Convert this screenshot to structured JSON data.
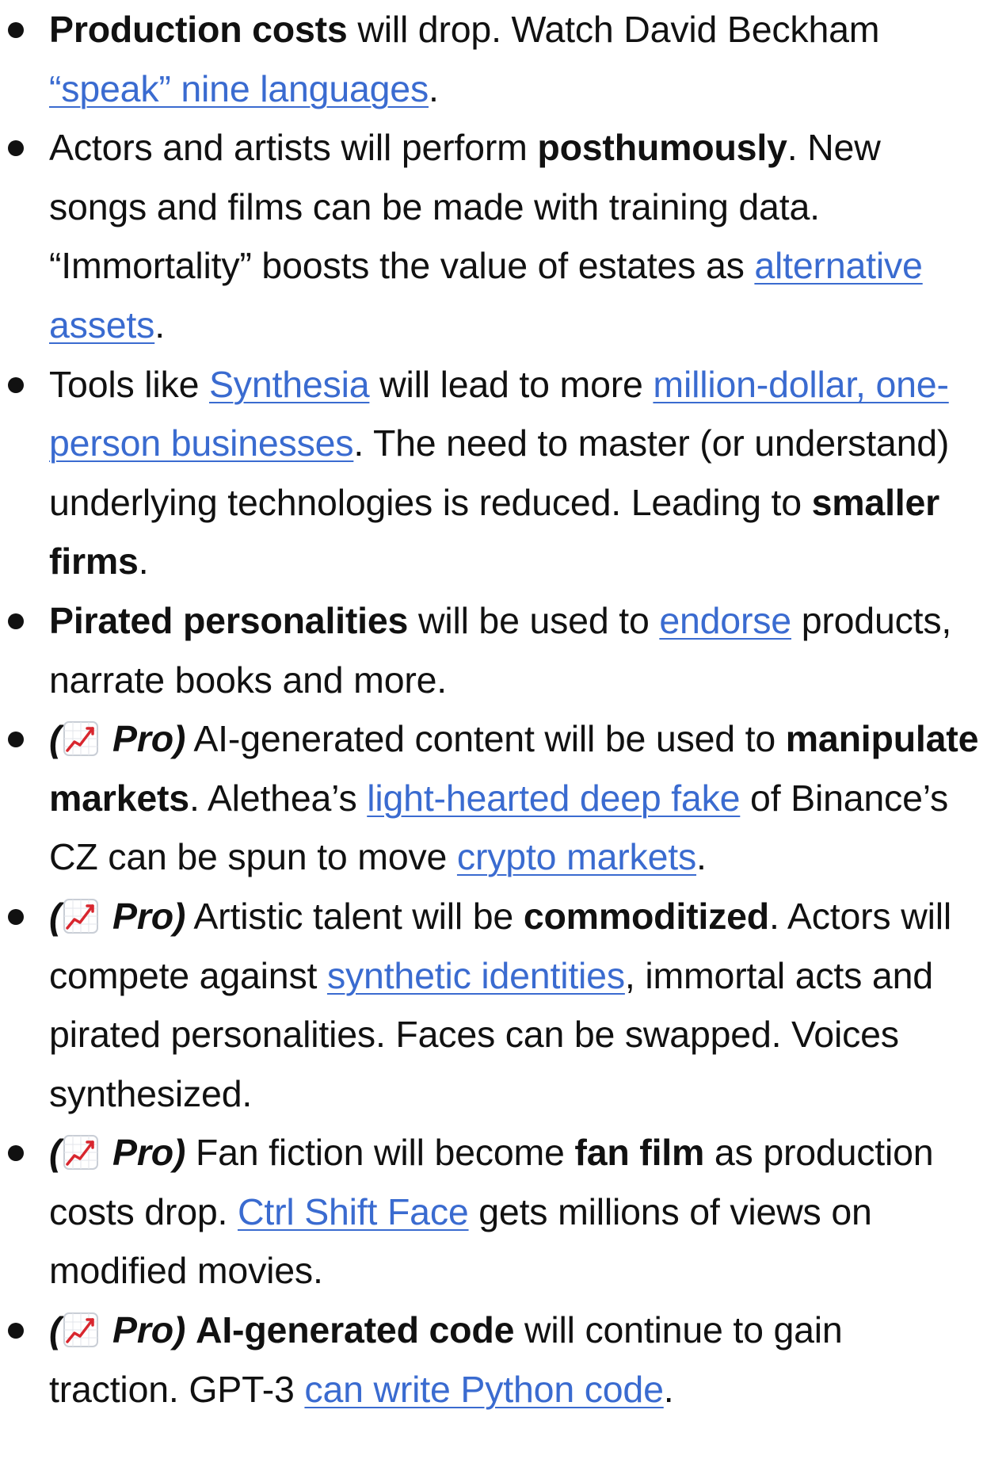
{
  "items": [
    {
      "segments": [
        {
          "type": "bold",
          "text": "Production costs"
        },
        {
          "type": "text",
          "text": " will drop. Watch David Beckham "
        },
        {
          "type": "link",
          "text": "“speak” nine languages"
        },
        {
          "type": "text",
          "text": "."
        }
      ]
    },
    {
      "segments": [
        {
          "type": "text",
          "text": "Actors and artists will perform "
        },
        {
          "type": "bold",
          "text": "posthumously"
        },
        {
          "type": "text",
          "text": ". New songs and films can be made with training data. “Immortality” boosts the value of estates as "
        },
        {
          "type": "link",
          "text": "alternative assets"
        },
        {
          "type": "text",
          "text": "."
        }
      ]
    },
    {
      "segments": [
        {
          "type": "text",
          "text": "Tools like "
        },
        {
          "type": "link",
          "text": "Synthesia"
        },
        {
          "type": "text",
          "text": " will lead to more "
        },
        {
          "type": "link",
          "text": "million-dollar, one-person businesses"
        },
        {
          "type": "text",
          "text": ". The need to master (or understand) underlying technologies is reduced. Leading to "
        },
        {
          "type": "bold",
          "text": "smaller firms"
        },
        {
          "type": "text",
          "text": "."
        }
      ]
    },
    {
      "segments": [
        {
          "type": "bold",
          "text": "Pirated personalities"
        },
        {
          "type": "text",
          "text": " will be used to "
        },
        {
          "type": "link",
          "text": "endorse"
        },
        {
          "type": "text",
          "text": " products, narrate books and more."
        }
      ]
    },
    {
      "segments": [
        {
          "type": "pro",
          "open": "(",
          "label": " Pro)",
          "icon": "chart-increasing-icon"
        },
        {
          "type": "text",
          "text": " AI-generated content will be used to "
        },
        {
          "type": "bold",
          "text": "manipulate markets"
        },
        {
          "type": "text",
          "text": ". Alethea’s "
        },
        {
          "type": "link",
          "text": "light-hearted deep fake"
        },
        {
          "type": "text",
          "text": " of Binance’s CZ can be spun to move "
        },
        {
          "type": "link",
          "text": "crypto markets"
        },
        {
          "type": "text",
          "text": "."
        }
      ]
    },
    {
      "segments": [
        {
          "type": "pro",
          "open": "(",
          "label": " Pro)",
          "icon": "chart-increasing-icon"
        },
        {
          "type": "text",
          "text": " Artistic talent will be "
        },
        {
          "type": "bold",
          "text": "commoditized"
        },
        {
          "type": "text",
          "text": ". Actors will compete against "
        },
        {
          "type": "link",
          "text": "synthetic identities"
        },
        {
          "type": "text",
          "text": ", immortal acts and pirated personalities. Faces can be swapped. Voices synthesized."
        }
      ]
    },
    {
      "segments": [
        {
          "type": "pro",
          "open": "(",
          "label": " Pro)",
          "icon": "chart-increasing-icon"
        },
        {
          "type": "text",
          "text": " Fan fiction will become "
        },
        {
          "type": "bold",
          "text": "fan film"
        },
        {
          "type": "text",
          "text": " as production costs drop. "
        },
        {
          "type": "link",
          "text": "Ctrl Shift Face"
        },
        {
          "type": "text",
          "text": " gets millions of views on modified movies."
        }
      ]
    },
    {
      "segments": [
        {
          "type": "pro",
          "open": "(",
          "label": " Pro)",
          "icon": "chart-increasing-icon"
        },
        {
          "type": "text",
          "text": " "
        },
        {
          "type": "bold",
          "text": "AI-generated code"
        },
        {
          "type": "text",
          "text": " will continue to gain traction. GPT-3 "
        },
        {
          "type": "link",
          "text": "can write Python code"
        },
        {
          "type": "text",
          "text": "."
        }
      ]
    }
  ],
  "colors": {
    "text": "#111111",
    "link": "#3a6bd0",
    "chart_line": "#d8262e"
  }
}
